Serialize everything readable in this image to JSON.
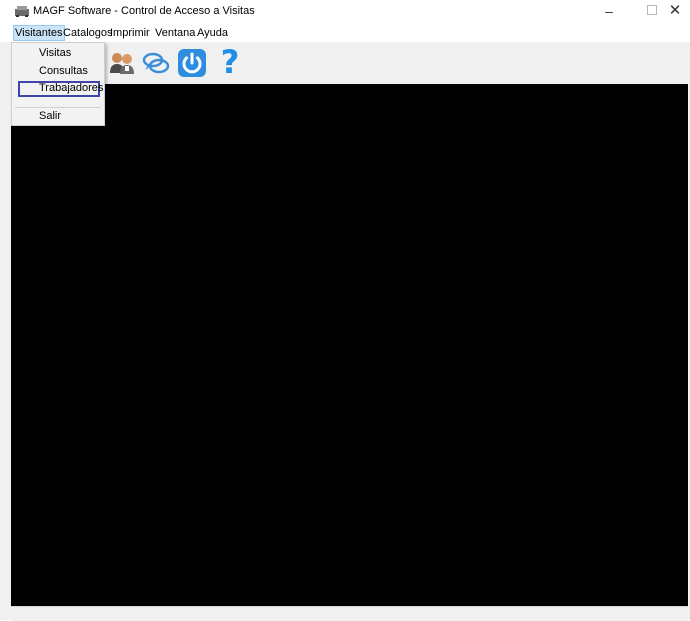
{
  "window": {
    "title": "MAGF Software - Control de Acceso a Visitas",
    "minimize_glyph": "–",
    "close_glyph": "✕"
  },
  "menubar": {
    "items": [
      "Visitantes",
      "Catalogos",
      "Imprimir",
      "Ventana",
      "Ayuda"
    ],
    "active": "Visitantes"
  },
  "dropdown": {
    "items": [
      "Visitas",
      "Consultas",
      "Trabajadores",
      "Salir"
    ],
    "highlighted": "Trabajadores"
  },
  "toolbar": {
    "buttons": [
      {
        "icon": "users-icon"
      },
      {
        "icon": "chat-bubbles-icon"
      },
      {
        "icon": "power-icon"
      },
      {
        "icon": "help-question-icon",
        "glyph": "?"
      }
    ]
  },
  "colors": {
    "mdi_background": "#000000",
    "highlight_border": "#3e44a8",
    "question_mark": "#1e8ee6",
    "power_button": "#2d8ee0"
  }
}
